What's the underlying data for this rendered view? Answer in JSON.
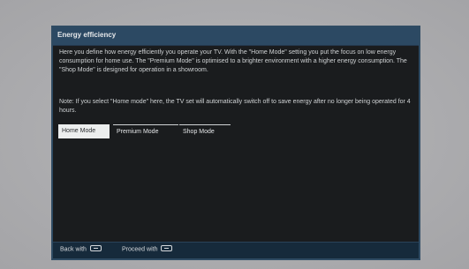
{
  "dialog": {
    "title": "Energy efficiency",
    "paragraph1": "Here you define how energy efficiently you operate your TV. With the \"Home Mode\" setting you put the focus on low energy consumption for home use. The \"Premium Mode\" is optimised to a brighter environment with a higher energy consumption. The \"Shop Mode\" is designed for operation in a showroom.",
    "paragraph2": "Note: If you select \"Home mode\" here, the TV set will automatically switch off to save energy after no longer being operated for 4 hours.",
    "modes": [
      {
        "label": "Home Mode",
        "selected": true
      },
      {
        "label": "Premium Mode",
        "selected": false
      },
      {
        "label": "Shop Mode",
        "selected": false
      }
    ]
  },
  "footer": {
    "back_label": "Back with",
    "back_key_icon": "back-key-icon",
    "proceed_label": "Proceed with",
    "proceed_key_icon": "ok-key-icon"
  },
  "colors": {
    "dialog_background": "#1a1c1e",
    "title_bar": "#2c4963",
    "footer_bar": "#162a3b",
    "selected_button": "#eceeee",
    "screen_surround": "#b2b2b5"
  }
}
